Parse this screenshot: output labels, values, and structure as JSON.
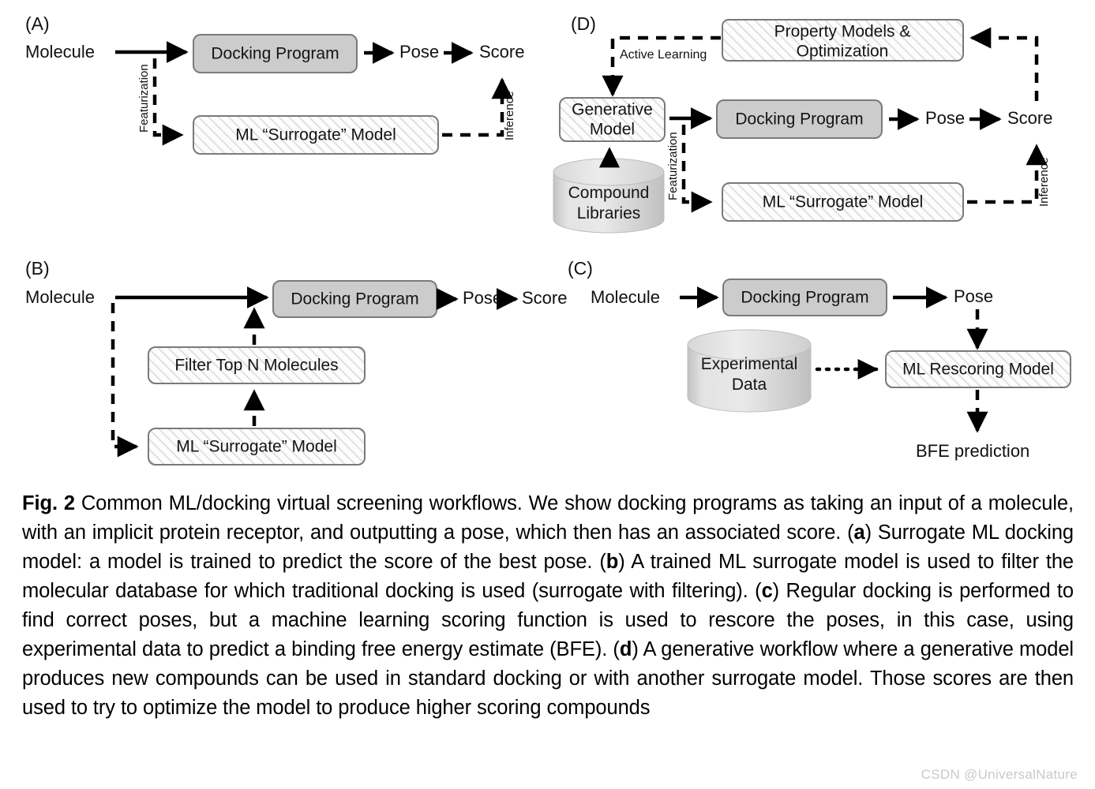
{
  "figure": {
    "panels": [
      {
        "id": "A",
        "label": "(A)",
        "nodes": {
          "input": "Molecule",
          "docking": "Docking Program",
          "pose": "Pose",
          "score": "Score",
          "surrogate": "ML “Surrogate” Model"
        },
        "edges": {
          "featurization": "Featurization",
          "inference": "Inference"
        }
      },
      {
        "id": "B",
        "label": "(B)",
        "nodes": {
          "input": "Molecule",
          "docking": "Docking Program",
          "pose": "Pose",
          "score": "Score",
          "filter": "Filter Top N Molecules",
          "surrogate": "ML “Surrogate” Model"
        }
      },
      {
        "id": "C",
        "label": "(C)",
        "nodes": {
          "input": "Molecule",
          "docking": "Docking Program",
          "pose": "Pose",
          "database": "Experimental\nData",
          "database_line1": "Experimental",
          "database_line2": "Data",
          "rescoring": "ML Rescoring Model",
          "output": "BFE prediction"
        }
      },
      {
        "id": "D",
        "label": "(D)",
        "nodes": {
          "property_line1": "Property Models &",
          "property_line2": "Optimization",
          "generative_line1": "Generative",
          "generative_line2": "Model",
          "library_line1": "Compound",
          "library_line2": "Libraries",
          "docking": "Docking Program",
          "pose": "Pose",
          "score": "Score",
          "surrogate": "ML “Surrogate” Model"
        },
        "edges": {
          "active_learning": "Active Learning",
          "featurization": "Featurization",
          "inference": "Inference"
        }
      }
    ]
  },
  "caption": {
    "figure_number": "Fig. 2",
    "text_1": " Common ML/docking virtual screening workflows. We show docking programs as taking an input of a molecule, with an implicit protein receptor, and outputting a pose, which then has an associated score. (",
    "marker_a": "a",
    "text_2": ") Surrogate ML docking model: a model is trained to predict the score of the best pose. (",
    "marker_b": "b",
    "text_3": ") A trained ML surrogate model is used to filter the molecular database for which traditional docking is used (surrogate with filtering). (",
    "marker_c": "c",
    "text_4": ") Regular docking is performed to find correct poses, but a machine learning scoring function is used to rescore the poses, in this case, using experimental data to predict a binding free energy estimate (BFE). (",
    "marker_d": "d",
    "text_5": ") A generative workflow where a generative model produces new compounds can be used in standard docking or with another surrogate model. Those scores are then used to try to optimize the model to produce higher scoring compounds"
  },
  "watermark": {
    "text": "CSDN @UniversalNature"
  },
  "colors": {
    "box_gray_fill": "#cccccc",
    "box_stroke": "#7a7a7a",
    "hatch_stroke": "#d5d5d5",
    "line": "#000000",
    "cylinder_light": "#eeeeee",
    "cylinder_dark": "#c4c4c4",
    "watermark": "#c9c9c9"
  }
}
